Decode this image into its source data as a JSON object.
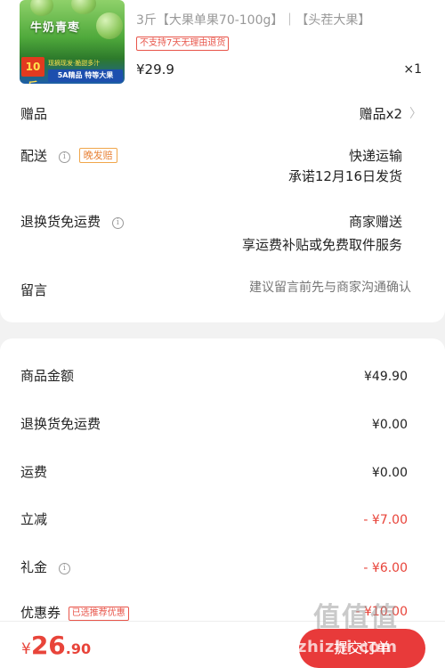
{
  "product": {
    "spec": "3斤【大果单果70-100g】｜【头茬大果】",
    "tag": "不支持7天无理由退货",
    "price": "¥29.9",
    "quantity": "×1",
    "image": {
      "brand": "牛奶青枣",
      "weight": "10斤",
      "promo": "现摘现发·脆甜多汁",
      "grade": "5A精品 特等大果"
    }
  },
  "gift": {
    "label": "赠品",
    "value": "赠品x2"
  },
  "delivery": {
    "label": "配送",
    "tag": "晚发赔",
    "method": "快递运输",
    "promise": "承诺12月16日发货"
  },
  "return_shipping": {
    "label": "退换货免运费",
    "value": "商家赠送",
    "detail": "享运费补贴或免费取件服务"
  },
  "message": {
    "label": "留言",
    "placeholder": "建议留言前先与商家沟通确认"
  },
  "summary": {
    "goods_amount": {
      "label": "商品金额",
      "value": "¥49.90"
    },
    "return_free": {
      "label": "退换货免运费",
      "value": "¥0.00"
    },
    "shipping": {
      "label": "运费",
      "value": "¥0.00"
    },
    "discount": {
      "label": "立减",
      "value": "- ¥7.00"
    },
    "gift_money": {
      "label": "礼金",
      "value": "- ¥6.00"
    },
    "coupon": {
      "label": "优惠券",
      "tag": "已选推荐优惠",
      "value": "- ¥10.00"
    }
  },
  "footer": {
    "total_currency": "¥",
    "total_int": "26",
    "total_dec": ".90",
    "submit_label": "提交订单",
    "watermark": "zhizhi.com",
    "watermark_logo": "值值值"
  },
  "colors": {
    "accent": "#e8443a",
    "tag_orange": "#e8843a",
    "background": "#f2f2f2"
  }
}
